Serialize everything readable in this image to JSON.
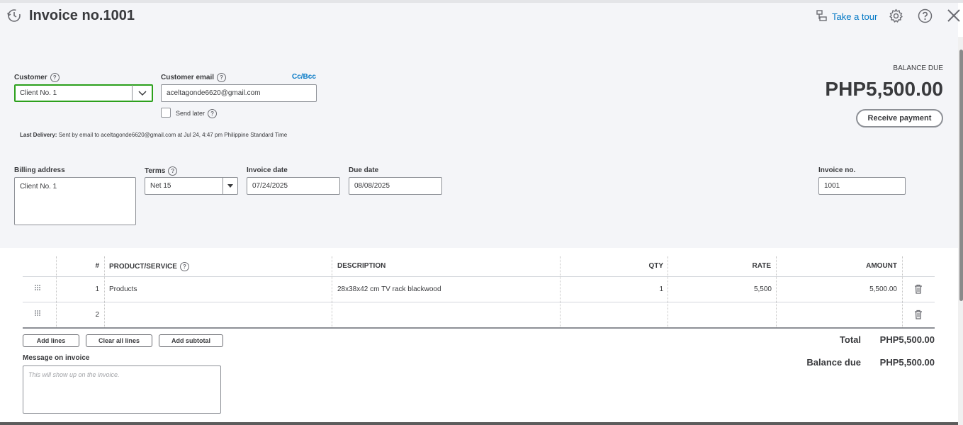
{
  "header": {
    "title": "Invoice no.1001",
    "take_tour": "Take a tour"
  },
  "customer": {
    "label": "Customer",
    "value": "Client No. 1"
  },
  "email": {
    "label": "Customer email",
    "value": "aceltagonde6620@gmail.com",
    "cc_bcc": "Cc/Bcc",
    "send_later": "Send later"
  },
  "last_delivery": {
    "label": "Last Delivery:",
    "text": "Sent by email to aceltagonde6620@gmail.com at Jul 24, 4:47 pm Philippine Standard Time"
  },
  "balance": {
    "label": "BALANCE DUE",
    "amount": "PHP5,500.00",
    "receive_payment": "Receive payment"
  },
  "billing": {
    "label": "Billing address",
    "value": "Client No. 1"
  },
  "terms": {
    "label": "Terms",
    "value": "Net 15"
  },
  "invoice_date": {
    "label": "Invoice date",
    "value": "07/24/2025"
  },
  "due_date": {
    "label": "Due date",
    "value": "08/08/2025"
  },
  "invoice_no": {
    "label": "Invoice no.",
    "value": "1001"
  },
  "table": {
    "headers": {
      "num": "#",
      "product": "PRODUCT/SERVICE",
      "description": "DESCRIPTION",
      "qty": "QTY",
      "rate": "RATE",
      "amount": "AMOUNT"
    },
    "rows": [
      {
        "num": "1",
        "product": "Products",
        "description": "28x38x42 cm TV rack blackwood",
        "qty": "1",
        "rate": "5,500",
        "amount": "5,500.00"
      },
      {
        "num": "2",
        "product": "",
        "description": "",
        "qty": "",
        "rate": "",
        "amount": ""
      }
    ]
  },
  "actions": {
    "add_lines": "Add lines",
    "clear_all_lines": "Clear all lines",
    "add_subtotal": "Add subtotal"
  },
  "message": {
    "label": "Message on invoice",
    "placeholder": "This will show up on the invoice."
  },
  "totals": {
    "total_label": "Total",
    "total_value": "PHP5,500.00",
    "balance_due_label": "Balance due",
    "balance_due_value": "PHP5,500.00"
  },
  "colors": {
    "accent_link": "#0077c5",
    "focus_green": "#2ca01c",
    "header_bg": "#f4f5f8"
  }
}
